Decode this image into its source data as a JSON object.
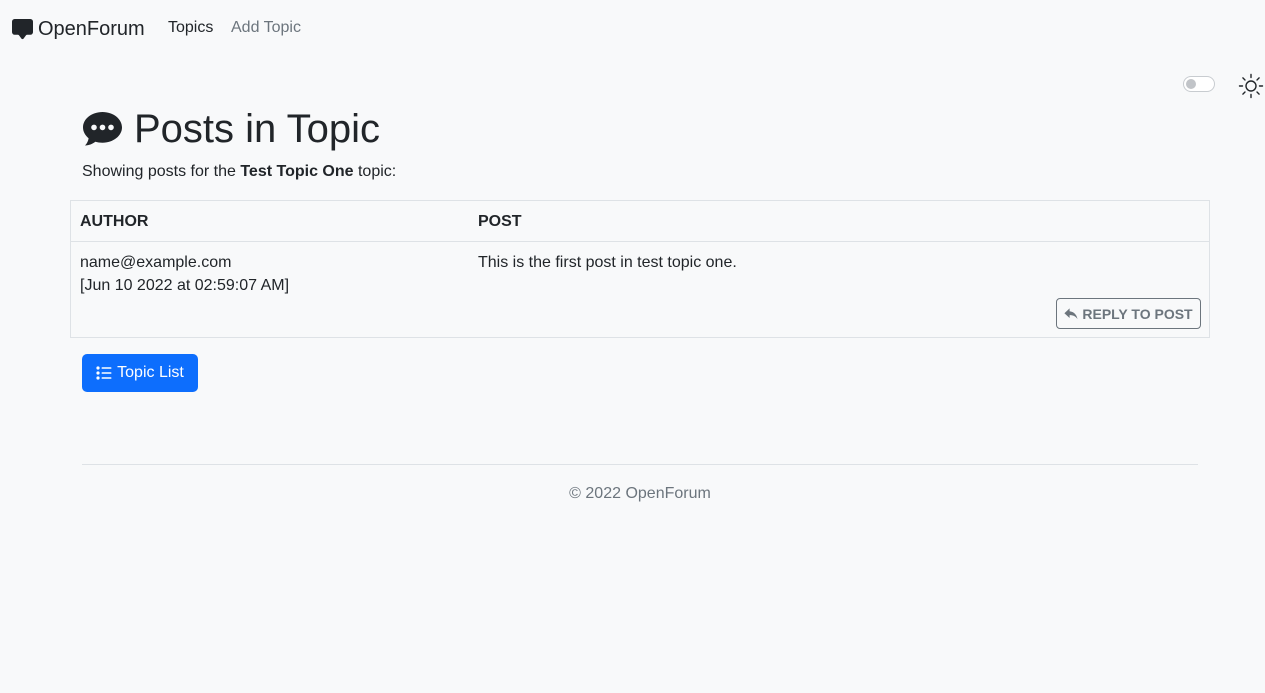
{
  "navbar": {
    "brand": "OpenForum",
    "brand_icon": "chat-square-fill-icon",
    "links": [
      {
        "label": "Topics"
      },
      {
        "label": "Add Topic"
      }
    ]
  },
  "theme": {
    "toggle_on": false,
    "icon": "sun-icon"
  },
  "page": {
    "title": "Posts in Topic",
    "title_icon": "chat-dots-fill-icon",
    "subtitle_prefix": "Showing posts for the",
    "topic_name": "Test Topic One",
    "subtitle_suffix": "topic:"
  },
  "table": {
    "headers": {
      "author": "AUTHOR",
      "post": "POST"
    },
    "rows": [
      {
        "author_email": "name@example.com",
        "timestamp": "[Jun 10 2022 at 02:59:07 AM]",
        "post_text": "This is the first post in test topic one.",
        "reply_label": "REPLY TO POST",
        "reply_icon": "reply-icon"
      }
    ]
  },
  "actions": {
    "topic_list_label": "Topic List",
    "topic_list_icon": "list-ul-icon"
  },
  "footer": {
    "text": "© 2022 OpenForum"
  },
  "colors": {
    "background": "#f8f9fa",
    "primary": "#0d6efd",
    "muted": "#6c757d",
    "text": "#212529",
    "border": "#dee2e6"
  }
}
